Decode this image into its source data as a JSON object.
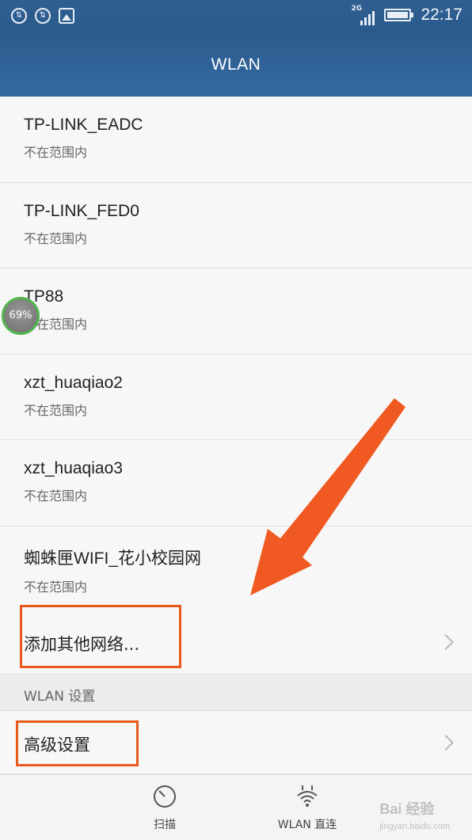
{
  "status_bar": {
    "network_type": "2G",
    "time": "22:17",
    "icons": [
      "sync-icon",
      "sync-icon",
      "image-icon",
      "signal-icon",
      "battery-icon"
    ]
  },
  "header": {
    "title": "WLAN"
  },
  "networks": [
    {
      "ssid": "TP-LINK_EADC",
      "status": "不在范围内"
    },
    {
      "ssid": "TP-LINK_FED0",
      "status": "不在范围内"
    },
    {
      "ssid": "TP88",
      "status": "不在范围内"
    },
    {
      "ssid": "xzt_huaqiao2",
      "status": "不在范围内"
    },
    {
      "ssid": "xzt_huaqiao3",
      "status": "不在范围内"
    },
    {
      "ssid": "蜘蛛匣WIFI_花小校园网",
      "status": "不在范围内"
    }
  ],
  "add_network_label": "添加其他网络...",
  "settings_section_label": "WLAN 设置",
  "advanced_settings_label": "高级设置",
  "bottom_tabs": [
    {
      "label": "扫描",
      "icon": "scan-icon"
    },
    {
      "label": "WLAN 直连",
      "icon": "wifi-direct-icon"
    }
  ],
  "floating_badge": {
    "text": "69%"
  },
  "watermark": {
    "text": "Bai 经验",
    "sub": "jingyan.baidu.com"
  },
  "colors": {
    "header": "#2f5e91",
    "annotation": "#e85a1b",
    "badge_ring": "#53b44c"
  }
}
